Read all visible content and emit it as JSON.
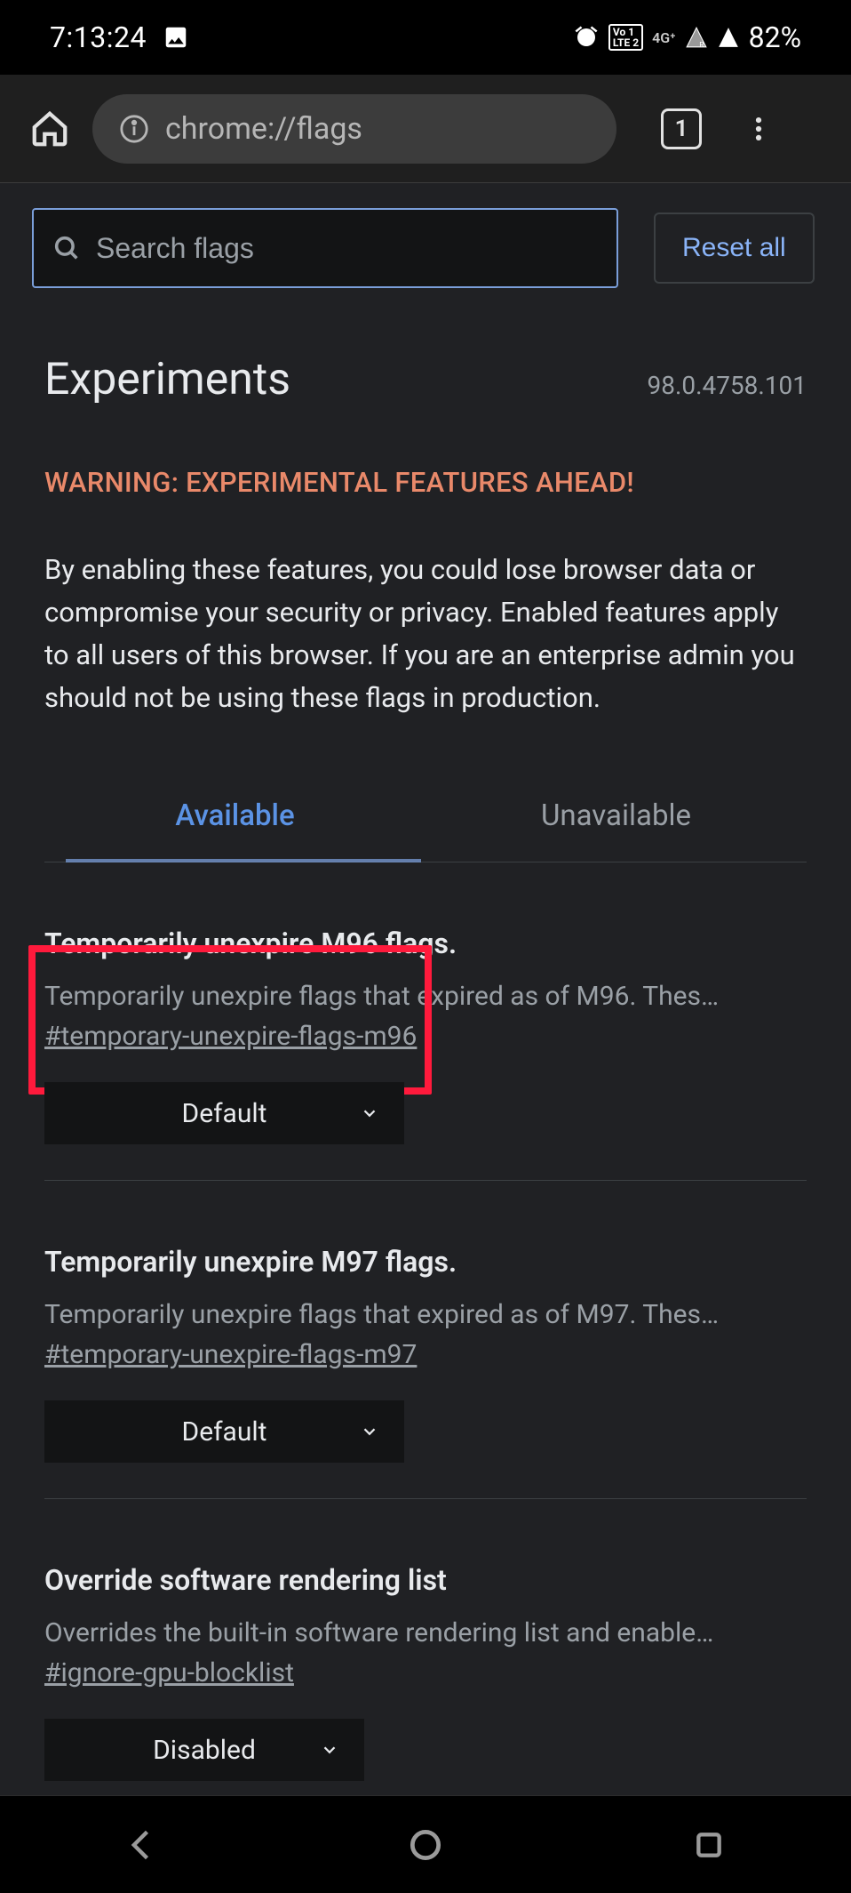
{
  "status": {
    "time": "7:13:24",
    "battery": "82%"
  },
  "browser": {
    "url": "chrome://flags",
    "tab_count": "1"
  },
  "search": {
    "placeholder": "Search flags",
    "reset_label": "Reset all"
  },
  "header": {
    "title": "Experiments",
    "version": "98.0.4758.101",
    "warning_heading": "WARNING: EXPERIMENTAL FEATURES AHEAD!",
    "warning_body": "By enabling these features, you could lose browser data or compromise your security or privacy. Enabled features apply to all users of this browser. If you are an enterprise admin you should not be using these flags in production."
  },
  "tabs": {
    "available": "Available",
    "unavailable": "Unavailable"
  },
  "flags": [
    {
      "title": "Temporarily unexpire M96 flags.",
      "desc": "Temporarily unexpire flags that expired as of M96. Thes…",
      "hash": "#temporary-unexpire-flags-m96",
      "value": "Default"
    },
    {
      "title": "Temporarily unexpire M97 flags.",
      "desc": "Temporarily unexpire flags that expired as of M97. Thes…",
      "hash": "#temporary-unexpire-flags-m97",
      "value": "Default"
    },
    {
      "title": "Override software rendering list",
      "desc": "Overrides the built-in software rendering list and enable…",
      "hash": "#ignore-gpu-blocklist",
      "value": "Disabled"
    }
  ]
}
